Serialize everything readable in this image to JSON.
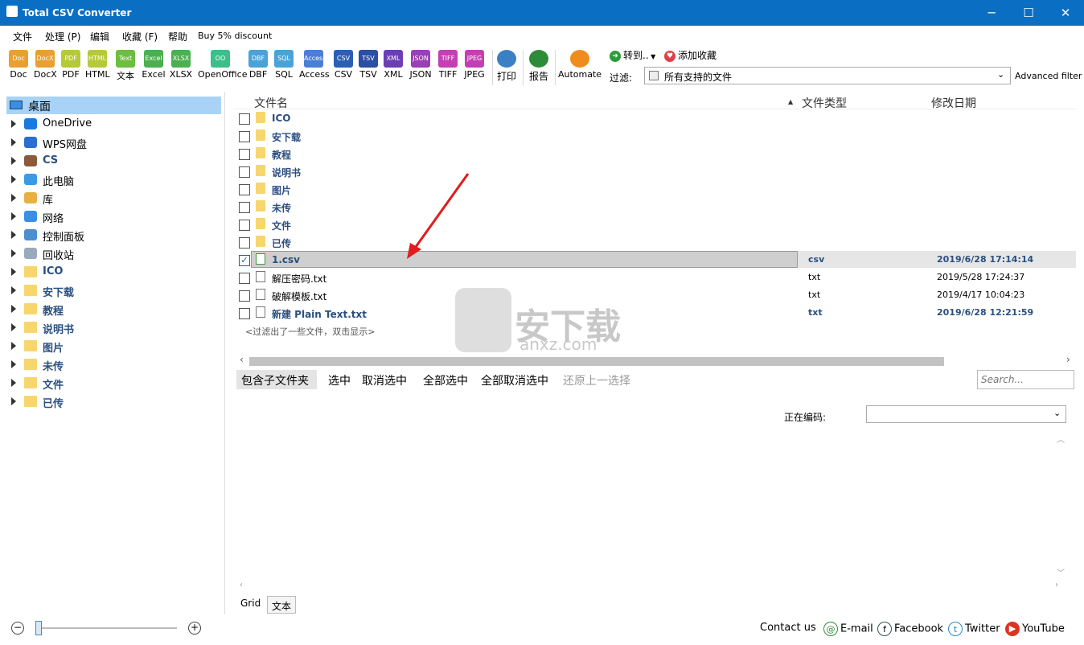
{
  "window": {
    "title": "Total CSV Converter",
    "minimize": "─",
    "maximize": "☐",
    "close": "✕"
  },
  "menu": [
    "文件",
    "处理 (P)",
    "编辑",
    "收藏 (F)",
    "帮助",
    "Buy 5% discount"
  ],
  "toolbar": {
    "formats": [
      {
        "label": "Doc",
        "icon_text": "Doc",
        "color": "#e9a030"
      },
      {
        "label": "DocX",
        "icon_text": "DocX",
        "color": "#e9a030"
      },
      {
        "label": "PDF",
        "icon_text": "PDF",
        "color": "#b6c93a"
      },
      {
        "label": "HTML",
        "icon_text": "HTML",
        "color": "#b6c93a"
      },
      {
        "label": "文本",
        "icon_text": "Text",
        "color": "#6dbd3f"
      },
      {
        "label": "Excel",
        "icon_text": "Excel",
        "color": "#4caf50"
      },
      {
        "label": "XLSX",
        "icon_text": "XLSX",
        "color": "#4caf50"
      },
      {
        "label": "OpenOffice",
        "icon_text": "OO",
        "color": "#3cbf8a"
      },
      {
        "label": "DBF",
        "icon_text": "DBF",
        "color": "#4aa3d8"
      },
      {
        "label": "SQL",
        "icon_text": "SQL",
        "color": "#4aa3d8"
      },
      {
        "label": "Access",
        "icon_text": "Access",
        "color": "#4a7fd8"
      },
      {
        "label": "CSV",
        "icon_text": "CSV",
        "color": "#2b5fb4"
      },
      {
        "label": "TSV",
        "icon_text": "TSV",
        "color": "#2b4fa4"
      },
      {
        "label": "XML",
        "icon_text": "XML",
        "color": "#6a3fb4"
      },
      {
        "label": "JSON",
        "icon_text": "JSON",
        "color": "#9a3fb4"
      },
      {
        "label": "TIFF",
        "icon_text": "TIFF",
        "color": "#c53fb4"
      },
      {
        "label": "JPEG",
        "icon_text": "JPEG",
        "color": "#c53fb4"
      }
    ],
    "print": "打印",
    "report": "报告",
    "automate": "Automate",
    "goto": "转到..",
    "add_favorite": "添加收藏",
    "filter_label": "过滤:",
    "filter_value": "所有支持的文件",
    "advanced_filter": "Advanced filter"
  },
  "tree": {
    "root": "桌面",
    "items": [
      {
        "label": "OneDrive",
        "icon": "cloud-icon",
        "folder": false,
        "bold": false
      },
      {
        "label": "WPS网盘",
        "icon": "wps-cloud-icon",
        "folder": false,
        "bold": false
      },
      {
        "label": "CS",
        "icon": "user-icon",
        "folder": false,
        "bold": true
      },
      {
        "label": "此电脑",
        "icon": "computer-icon",
        "folder": false,
        "bold": false
      },
      {
        "label": "库",
        "icon": "library-icon",
        "folder": false,
        "bold": false
      },
      {
        "label": "网络",
        "icon": "network-icon",
        "folder": false,
        "bold": false
      },
      {
        "label": "控制面板",
        "icon": "control-panel-icon",
        "folder": false,
        "bold": false
      },
      {
        "label": "回收站",
        "icon": "recycle-bin-icon",
        "folder": false,
        "bold": false
      },
      {
        "label": "ICO",
        "icon": "folder-icon",
        "folder": true,
        "bold": true
      },
      {
        "label": "安下载",
        "icon": "folder-icon",
        "folder": true,
        "bold": true
      },
      {
        "label": "教程",
        "icon": "folder-icon",
        "folder": true,
        "bold": true
      },
      {
        "label": "说明书",
        "icon": "folder-icon",
        "folder": true,
        "bold": true
      },
      {
        "label": "图片",
        "icon": "folder-icon",
        "folder": true,
        "bold": true
      },
      {
        "label": "未传",
        "icon": "folder-icon",
        "folder": true,
        "bold": true
      },
      {
        "label": "文件",
        "icon": "folder-icon",
        "folder": true,
        "bold": true
      },
      {
        "label": "已传",
        "icon": "folder-icon",
        "folder": true,
        "bold": true
      }
    ]
  },
  "filelist": {
    "columns": [
      "文件名",
      "文件类型",
      "修改日期"
    ],
    "rows": [
      {
        "name": "ICO",
        "type": "",
        "date": "",
        "kind": "folder",
        "checked": false,
        "bold": true
      },
      {
        "name": "安下载",
        "type": "",
        "date": "",
        "kind": "folder",
        "checked": false,
        "bold": true
      },
      {
        "name": "教程",
        "type": "",
        "date": "",
        "kind": "folder",
        "checked": false,
        "bold": true
      },
      {
        "name": "说明书",
        "type": "",
        "date": "",
        "kind": "folder",
        "checked": false,
        "bold": true
      },
      {
        "name": "图片",
        "type": "",
        "date": "",
        "kind": "folder",
        "checked": false,
        "bold": true
      },
      {
        "name": "未传",
        "type": "",
        "date": "",
        "kind": "folder",
        "checked": false,
        "bold": true
      },
      {
        "name": "文件",
        "type": "",
        "date": "",
        "kind": "folder",
        "checked": false,
        "bold": true
      },
      {
        "name": "已传",
        "type": "",
        "date": "",
        "kind": "folder",
        "checked": false,
        "bold": true
      },
      {
        "name": "1.csv",
        "type": "csv",
        "date": "2019/6/28 17:14:14",
        "kind": "csv",
        "checked": true,
        "bold": true
      },
      {
        "name": "解压密码.txt",
        "type": "txt",
        "date": "2019/5/28 17:24:37",
        "kind": "txt",
        "checked": false,
        "bold": false
      },
      {
        "name": "破解模板.txt",
        "type": "txt",
        "date": "2019/4/17 10:04:23",
        "kind": "txt",
        "checked": false,
        "bold": false
      },
      {
        "name": "新建 Plain Text.txt",
        "type": "txt",
        "date": "2019/6/28 12:21:59",
        "kind": "txt",
        "checked": false,
        "bold": true
      }
    ],
    "filtered_note": "<过滤出了一些文件，双击显示>"
  },
  "actions": {
    "include_subfolders": "包含子文件夹",
    "select": "选中",
    "deselect": "取消选中",
    "select_all": "全部选中",
    "deselect_all": "全部取消选中",
    "restore": "还原上一选择",
    "search_placeholder": "Search..."
  },
  "preview": {
    "encoding_label": "正在编码:",
    "tabs": [
      "Grid",
      "文本"
    ]
  },
  "watermark": {
    "text": "安下载",
    "sub": "anxz.com"
  },
  "status": {
    "contact": "Contact us",
    "email": "E-mail",
    "facebook": "Facebook",
    "twitter": "Twitter",
    "youtube": "YouTube"
  }
}
